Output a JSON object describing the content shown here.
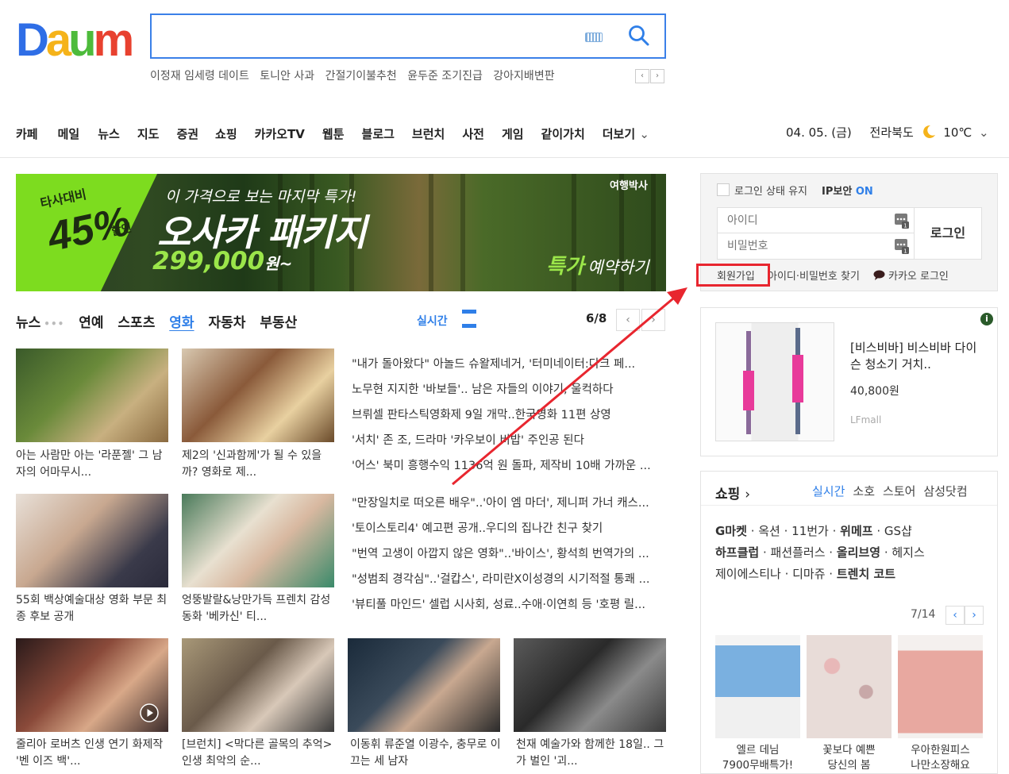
{
  "header": {
    "logo": "Daum",
    "search_placeholder": "",
    "hot_keywords": [
      "이정재 임세령 데이트",
      "토니안 사과",
      "간절기이불추천",
      "윤두준 조기진급",
      "강아지배변판"
    ]
  },
  "gnb": {
    "items": [
      "카페",
      "메일",
      "뉴스",
      "지도",
      "증권",
      "쇼핑",
      "카카오TV",
      "웹툰",
      "블로그",
      "브런치",
      "사전",
      "게임",
      "같이가치"
    ],
    "more": "더보기",
    "date": "04. 05. (금)",
    "region": "전라북도",
    "temperature": "10℃"
  },
  "banner": {
    "badge_top": "타사대비",
    "badge_pct": "45%",
    "badge_sale": "할인",
    "subtitle": "이 가격으로 보는 마지막 특가!",
    "title": "오사카 패키지",
    "price": "299,000",
    "price_unit": "원~",
    "brand": "여행박사",
    "cta_strong": "특가",
    "cta": "예약하기"
  },
  "news": {
    "tabs": [
      "뉴스",
      "연예",
      "스포츠",
      "영화",
      "자동차",
      "부동산"
    ],
    "active_tab": "영화",
    "realtime_label": "실시간",
    "page": "6/8",
    "thumbs": [
      {
        "caption": "아는 사람만 아는 '라푼젤' 그 남자의 어마무시..."
      },
      {
        "caption": "제2의 '신과함께'가 될 수 있을까? 영화로 제..."
      },
      {
        "caption": "55회 백상예술대상 영화 부문 최종 후보 공개"
      },
      {
        "caption": "엉뚱발랄&낭만가득 프렌치 감성동화 '베카신' 티..."
      },
      {
        "caption": "줄리아 로버츠 인생 연기 화제작 '벤 이즈 백'..."
      },
      {
        "caption": "[브런치] <막다른 골목의 추억>인생 최악의 순..."
      },
      {
        "caption": "이동휘 류준열 이광수, 충무로 이끄는 세 남자"
      },
      {
        "caption": "천재 예술가와 함께한 18일.. 그가 벌인 '괴..."
      }
    ],
    "headlines": [
      "\"내가 돌아왔다\" 아놀드 슈왈제네거, '터미네이터:다크 페...",
      "노무현 지지한 '바보들'.. 남은 자들의 이야기, 울컥하다",
      "브뤼셀 판타스틱영화제 9일 개막..한국영화 11편 상영",
      "'서치' 존 조, 드라마 '카우보이 비밥' 주인공 된다",
      "'어스' 북미 흥행수익 1136억 원 돌파, 제작비 10배 가까운 ...",
      "\"만장일치로 떠오른 배우\"..'아이 엠 마더', 제니퍼 가너 캐스...",
      "'토이스토리4' 예고편 공개..우디의 집나간 친구 찾기",
      "\"번역 고생이 아깝지 않은 영화\"..'바이스', 황석희 번역가의 ...",
      "\"성범죄 경각심\"..'걸캅스', 라미란X이성경의 시기적절 통쾌 ...",
      "'뷰티풀 마인드' 셀럽 시사회, 성료..수애·이연희 등 '호평 릴..."
    ]
  },
  "login": {
    "keep_login": "로그인 상태 유지",
    "ip_security": "IP보안",
    "ip_status": "ON",
    "id_placeholder": "아이디",
    "pw_placeholder": "비밀번호",
    "login_button": "로그인",
    "signup": "회원가입",
    "find_account": "아이디·비밀번호 찾기",
    "kakao_login": "카카오 로그인"
  },
  "ad": {
    "title": "[비스비바] 비스비바 다이슨 청소기 거치..",
    "price": "40,800원",
    "seller": "LFmall"
  },
  "shopping": {
    "title": "쇼핑",
    "tabs": [
      "실시간",
      "소호",
      "스토어",
      "삼성닷컴"
    ],
    "active_tab": "실시간",
    "links_row1": [
      {
        "label": "G마켓",
        "bold": true
      },
      {
        "label": "옥션",
        "bold": false
      },
      {
        "label": "11번가",
        "bold": false
      },
      {
        "label": "위메프",
        "bold": true
      },
      {
        "label": "GS샵",
        "bold": false
      }
    ],
    "links_row2": [
      {
        "label": "하프클럽",
        "bold": true
      },
      {
        "label": "패션플러스",
        "bold": false
      },
      {
        "label": "올리브영",
        "bold": true
      },
      {
        "label": "헤지스",
        "bold": false
      }
    ],
    "links_row3": [
      {
        "label": "제이에스티나",
        "bold": false
      },
      {
        "label": "디마쥬",
        "bold": false
      },
      {
        "label": "트렌치 코트",
        "bold": true
      }
    ],
    "page": "7/14",
    "products": [
      {
        "caption1": "엘르 데님",
        "caption2": "7900무배특가!"
      },
      {
        "caption1": "꽃보다 예쁜",
        "caption2": "당신의 봄"
      },
      {
        "caption1": "우아한원피스",
        "caption2": "나만소장해요"
      }
    ]
  },
  "colors": {
    "accent": "#2f7fe8",
    "highlight_red": "#e8262f"
  }
}
